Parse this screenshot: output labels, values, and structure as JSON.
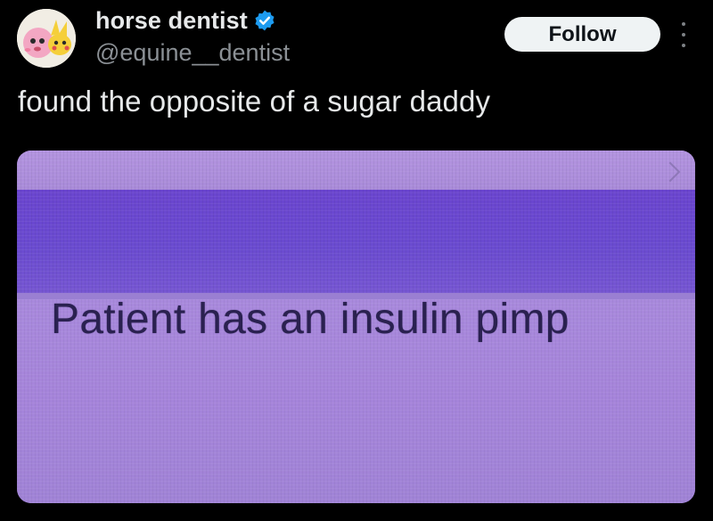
{
  "author": {
    "display_name": "horse dentist",
    "handle": "@equine__dentist",
    "verified": true,
    "verified_icon": "verified-badge-icon",
    "avatar_icon": "avatar-image"
  },
  "actions": {
    "follow_label": "Follow",
    "more_icon": "more-vertical-icon"
  },
  "post": {
    "text": "found the opposite of a sugar daddy"
  },
  "media": {
    "caption_in_image": "Patient has an insulin pimp"
  },
  "colors": {
    "background": "#000000",
    "primary_text": "#e7e9ea",
    "secondary_text": "#8b9095",
    "verified_blue": "#1d9bf0",
    "follow_bg": "#eff3f4",
    "media_purple": "#a583d6",
    "media_band": "#6a45cf"
  }
}
